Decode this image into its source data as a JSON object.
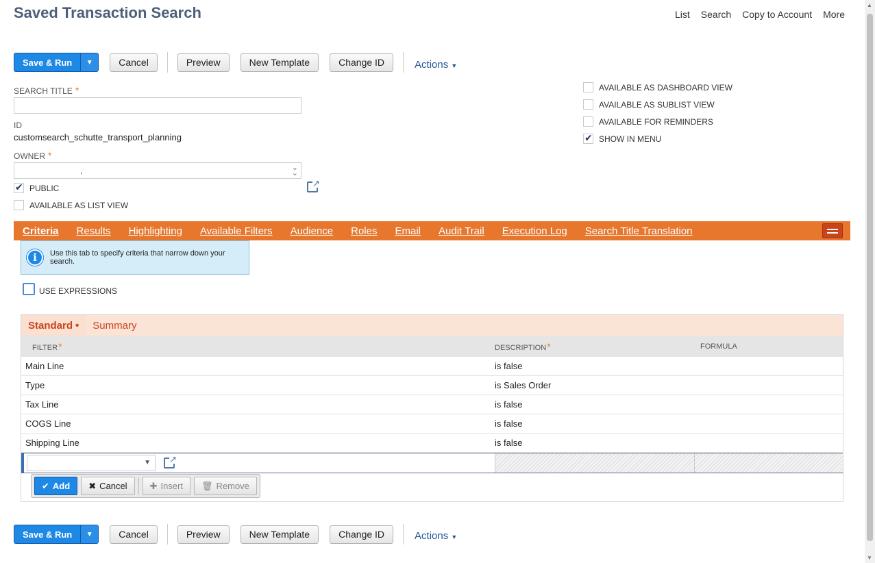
{
  "page": {
    "title": "Saved Transaction Search"
  },
  "topnav": [
    "List",
    "Search",
    "Copy to Account",
    "More"
  ],
  "toolbar": {
    "save_run": "Save & Run",
    "cancel": "Cancel",
    "preview": "Preview",
    "new_template": "New Template",
    "change_id": "Change ID",
    "actions": "Actions"
  },
  "form": {
    "search_title_label": "SEARCH TITLE",
    "search_title_value": "",
    "id_label": "ID",
    "id_value": "customsearch_schutte_transport_planning",
    "owner_label": "OWNER",
    "owner_value": ",",
    "public_label": "PUBLIC",
    "public_checked": true,
    "list_view_label": "AVAILABLE AS LIST VIEW",
    "list_view_checked": false
  },
  "options": [
    {
      "label": "AVAILABLE AS DASHBOARD VIEW",
      "checked": false
    },
    {
      "label": "AVAILABLE AS SUBLIST VIEW",
      "checked": false
    },
    {
      "label": "AVAILABLE FOR REMINDERS",
      "checked": false
    },
    {
      "label": "SHOW IN MENU",
      "checked": true
    }
  ],
  "tabs": [
    "Criteria",
    "Results",
    "Highlighting",
    "Available Filters",
    "Audience",
    "Roles",
    "Email",
    "Audit Trail",
    "Execution Log",
    "Search Title Translation"
  ],
  "info_text": "Use this tab to specify criteria that narrow down your search.",
  "use_expressions_label": "USE EXPRESSIONS",
  "subtabs": {
    "standard": "Standard",
    "summary": "Summary"
  },
  "grid": {
    "headers": {
      "filter": "FILTER",
      "description": "DESCRIPTION",
      "formula": "FORMULA"
    },
    "rows": [
      {
        "filter": "Main Line",
        "description": "is false",
        "formula": ""
      },
      {
        "filter": "Type",
        "description": "is Sales Order",
        "formula": ""
      },
      {
        "filter": "Tax Line",
        "description": "is false",
        "formula": ""
      },
      {
        "filter": "COGS Line",
        "description": "is false",
        "formula": ""
      },
      {
        "filter": "Shipping Line",
        "description": "is false",
        "formula": ""
      }
    ]
  },
  "line_buttons": {
    "add": "Add",
    "cancel": "Cancel",
    "insert": "Insert",
    "remove": "Remove"
  },
  "colors": {
    "accent": "#1e88e5",
    "tab_orange": "#e8772e",
    "title": "#4d5f79"
  }
}
